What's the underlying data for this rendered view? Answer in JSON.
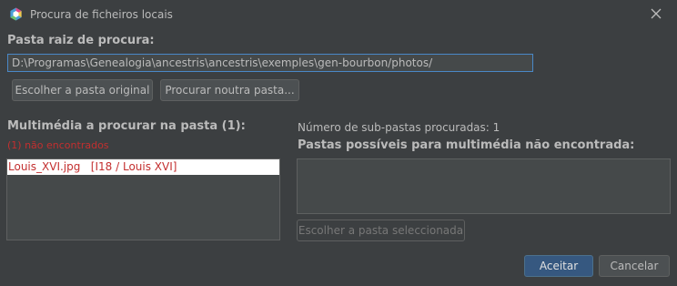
{
  "window": {
    "title": "Procura de ficheiros locais",
    "icon": "app-hexagon-icon",
    "close_icon": "close-icon"
  },
  "root_folder": {
    "label": "Pasta raiz de procura:",
    "path_value": "D:\\Programas\\Genealogia\\ancestris\\ancestris\\exemples\\gen-bourbon/photos/",
    "buttons": {
      "original": "Escolher a pasta original",
      "other": "Procurar noutra pasta..."
    }
  },
  "media_list": {
    "label": "Multimédia a procurar na pasta (1):",
    "not_found": "(1) não encontrados",
    "items": [
      "Louis_XVI.jpg   [I18 / Louis XVI]"
    ]
  },
  "subfolders": {
    "count_text": "Número de sub-pastas procuradas: 1",
    "label": "Pastas possíveis para multimédia não encontrada:",
    "choose_button": "Escolher a pasta seleccionada"
  },
  "footer": {
    "ok": "Aceitar",
    "cancel": "Cancelar"
  },
  "colors": {
    "background": "#3c3f41",
    "accent": "#365880",
    "error": "#c32f2f",
    "focus_border": "#4a88c7"
  }
}
